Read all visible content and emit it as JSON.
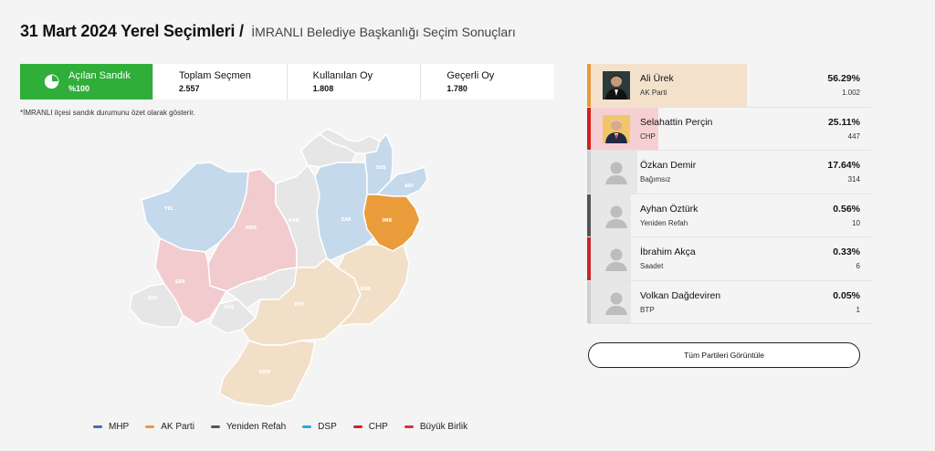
{
  "header": {
    "title": "31 Mart 2024 Yerel Seçimleri /",
    "subtitle": "İMRANLI Belediye Başkanlığı Seçim Sonuçları"
  },
  "stats": [
    {
      "label": "Açılan Sandık",
      "value": "%100",
      "icon": "pie-chart-icon"
    },
    {
      "label": "Toplam Seçmen",
      "value": "2.557"
    },
    {
      "label": "Kullanılan Oy",
      "value": "1.808"
    },
    {
      "label": "Geçerli Oy",
      "value": "1.780"
    }
  ],
  "note": "*İMRANLI ilçesi sandık durumunu özet olarak gösterir.",
  "map_regions": [
    {
      "code": "YEL",
      "color": "#c5d9ec"
    },
    {
      "code": "MER",
      "color": "#f2cbcf"
    },
    {
      "code": "KAN",
      "color": "#e6e6e6"
    },
    {
      "code": "ZAR",
      "color": "#c5d9ec"
    },
    {
      "code": "İMR",
      "color": "#ea9c3a"
    },
    {
      "code": "SUŞ",
      "color": "#c5d9ec"
    },
    {
      "code": "AKI",
      "color": "#c5d9ec"
    },
    {
      "code": "ŞAR",
      "color": "#f2cbcf"
    },
    {
      "code": "DİV",
      "color": "#e6e6e6"
    },
    {
      "code": "ULA",
      "color": "#e6e6e6"
    },
    {
      "code": "GOL",
      "color": "#e6e6e6"
    },
    {
      "code": "KOY",
      "color": "#f2dfc7"
    },
    {
      "code": "GÜR",
      "color": "#f2dfc7"
    },
    {
      "code": "GEM",
      "color": "#f2dfc7"
    }
  ],
  "legend": [
    {
      "label": "MHP",
      "color": "#3f6fb6"
    },
    {
      "label": "AK Parti",
      "color": "#e69a3c"
    },
    {
      "label": "Yeniden Refah",
      "color": "#555555"
    },
    {
      "label": "DSP",
      "color": "#2aa8e0"
    },
    {
      "label": "CHP",
      "color": "#d32020"
    },
    {
      "label": "Büyük Birlik",
      "color": "#d6323a"
    }
  ],
  "candidates": [
    {
      "name": "Ali Ürek",
      "party": "AK Parti",
      "percent": "56.29%",
      "share": 0.5629,
      "votes": "1.002",
      "stripe": "#e69a3c",
      "bar": "#f3e1cc"
    },
    {
      "name": "Selahattin Perçin",
      "party": "CHP",
      "percent": "25.11%",
      "share": 0.2511,
      "votes": "447",
      "stripe": "#d32020",
      "bar": "#f6cfd2"
    },
    {
      "name": "Özkan Demir",
      "party": "Bağımsız",
      "percent": "17.64%",
      "share": 0.1764,
      "votes": "314",
      "stripe": "#cfcfcf",
      "bar": "#e7e7e7"
    },
    {
      "name": "Ayhan Öztürk",
      "party": "Yeniden Refah",
      "percent": "0.56%",
      "share": 0.0056,
      "votes": "10",
      "stripe": "#555555",
      "bar": "#e7e7e7"
    },
    {
      "name": "İbrahim Akça",
      "party": "Saadet",
      "percent": "0.33%",
      "share": 0.0033,
      "votes": "6",
      "stripe": "#c62828",
      "bar": "#e7e7e7"
    },
    {
      "name": "Volkan Dağdeviren",
      "party": "BTP",
      "percent": "0.05%",
      "share": 0.0005,
      "votes": "1",
      "stripe": "#cfcfcf",
      "bar": "#e7e7e7"
    }
  ],
  "all_parties_button": "Tüm Partileri Görüntüle"
}
